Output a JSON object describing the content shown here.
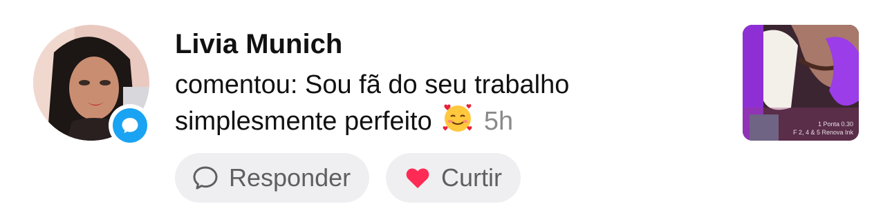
{
  "notification": {
    "user_name": "Livia Munich",
    "message": "comentou: Sou fã do seu trabalho simplesmente perfeito",
    "emoji": "🥰",
    "time": "5h"
  },
  "actions": {
    "reply_label": "Responder",
    "like_label": "Curtir"
  },
  "thumbnail": {
    "caption_line1": "1 Ponta 0.30",
    "caption_line2": "F 2, 4 & 5 Renova Ink"
  },
  "icons": {
    "badge": "comment-bubble-icon",
    "reply": "speech-bubble-outline-icon",
    "like": "heart-icon"
  },
  "colors": {
    "badge_blue": "#1aa3f2",
    "heart_red": "#ff2b55",
    "pill_bg": "#efeff1",
    "time_gray": "#8a8a8a",
    "label_gray": "#5f5f63"
  }
}
